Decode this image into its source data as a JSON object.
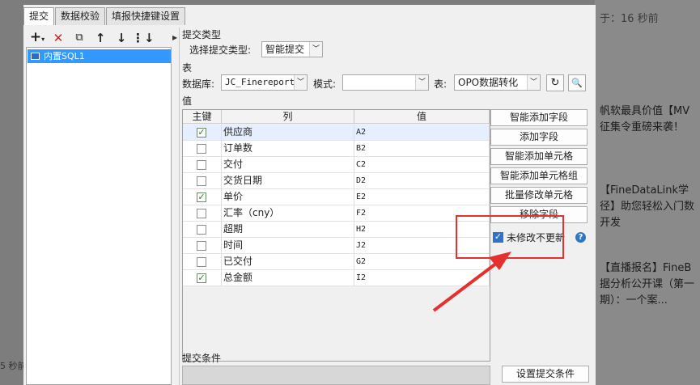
{
  "background": {
    "right_texts": [
      "于：16 秒前",
      "帆软最具价值【MV",
      "征集令重磅来袭！",
      "【FineDataLink学",
      "径】助您轻松入门数",
      "开发",
      "【直播报名】FineB",
      "据分析公开课（第一",
      "期）：一个案..."
    ],
    "left_text": "5 秒前"
  },
  "tabs": [
    {
      "label": "提交",
      "active": true
    },
    {
      "label": "数据校验",
      "active": false
    },
    {
      "label": "填报快捷键设置",
      "active": false
    }
  ],
  "toolbar": {
    "icons": [
      "add-icon",
      "delete-icon",
      "copy-icon",
      "move-up-icon",
      "move-down-icon",
      "move-bottom-icon"
    ]
  },
  "tree": {
    "items": [
      {
        "label": "内置SQL1",
        "selected": true
      }
    ]
  },
  "submit_type": {
    "section_label": "提交类型",
    "select_label": "选择提交类型:",
    "select_value": "智能提交"
  },
  "table_section": {
    "section_label": "表",
    "db_label": "数据库:",
    "db_value": "JC_Finereport",
    "mode_label": "模式:",
    "mode_value": "",
    "table_label": "表:",
    "table_value": "OPO数据转化"
  },
  "values": {
    "section_label": "值",
    "headers": [
      "主键",
      "列",
      "值"
    ],
    "rows": [
      {
        "key": true,
        "column": "供应商",
        "value": "A2"
      },
      {
        "key": false,
        "column": "订单数",
        "value": "B2"
      },
      {
        "key": false,
        "column": "交付",
        "value": "C2"
      },
      {
        "key": false,
        "column": "交货日期",
        "value": "D2"
      },
      {
        "key": true,
        "column": "单价",
        "value": "E2"
      },
      {
        "key": false,
        "column": "汇率（cny）",
        "value": "F2"
      },
      {
        "key": false,
        "column": "超期",
        "value": "H2"
      },
      {
        "key": false,
        "column": "时间",
        "value": "J2"
      },
      {
        "key": false,
        "column": "已交付",
        "value": "G2"
      },
      {
        "key": true,
        "column": "总金额",
        "value": "I2"
      }
    ]
  },
  "buttons": {
    "smart_add_field": "智能添加字段",
    "add_field": "添加字段",
    "smart_add_cell": "智能添加单元格",
    "smart_add_cell_group": "智能添加单元格组",
    "batch_modify_cell": "批量修改单元格",
    "remove_field": "移除字段"
  },
  "no_update_unmodified": {
    "label": "未修改不更新",
    "checked": true
  },
  "submit_condition": {
    "section_label": "提交条件",
    "button_label": "设置提交条件"
  },
  "colors": {
    "selection": "#3399ff",
    "highlight": "#e53030",
    "checkbox_blue": "#2e73c9"
  }
}
